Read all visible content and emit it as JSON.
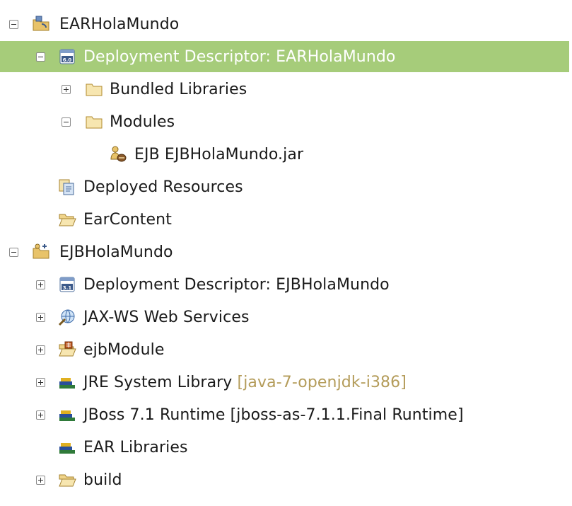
{
  "tree": {
    "rows": [
      {
        "label": "EARHolaMundo",
        "expanded": true,
        "icon": "ear-project-icon"
      },
      {
        "label": "Deployment Descriptor: EARHolaMundo",
        "expanded": true,
        "selected": true,
        "icon": "deployment-descriptor-6-0-icon",
        "icon_text": "6.0"
      },
      {
        "label": "Bundled Libraries",
        "expanded": false,
        "icon": "folder-icon"
      },
      {
        "label": "Modules",
        "expanded": true,
        "icon": "folder-icon"
      },
      {
        "label": "EJB EJBHolaMundo.jar",
        "icon": "ejb-module-icon"
      },
      {
        "label": "Deployed Resources",
        "icon": "deployed-resources-icon"
      },
      {
        "label": "EarContent",
        "icon": "open-folder-icon"
      },
      {
        "label": "EJBHolaMundo",
        "expanded": true,
        "icon": "ejb-project-icon"
      },
      {
        "label": "Deployment Descriptor: EJBHolaMundo",
        "expanded": false,
        "icon": "deployment-descriptor-3-1-icon",
        "icon_text": "3.1"
      },
      {
        "label": "JAX-WS Web Services",
        "expanded": false,
        "icon": "web-services-icon"
      },
      {
        "label": "ejbModule",
        "expanded": false,
        "icon": "source-folder-icon"
      },
      {
        "label": "JRE System Library",
        "decoration": "[java-7-openjdk-i386]",
        "expanded": false,
        "icon": "library-icon"
      },
      {
        "label": "JBoss 7.1 Runtime [jboss-as-7.1.1.Final Runtime]",
        "expanded": false,
        "icon": "library-icon"
      },
      {
        "label": "EAR Libraries",
        "icon": "library-icon"
      },
      {
        "label": "build",
        "expanded": false,
        "icon": "open-folder-icon"
      }
    ]
  },
  "colors": {
    "selection": "#a6cc7a",
    "decoration": "#b49c5a",
    "folder": "#e8c36a"
  }
}
